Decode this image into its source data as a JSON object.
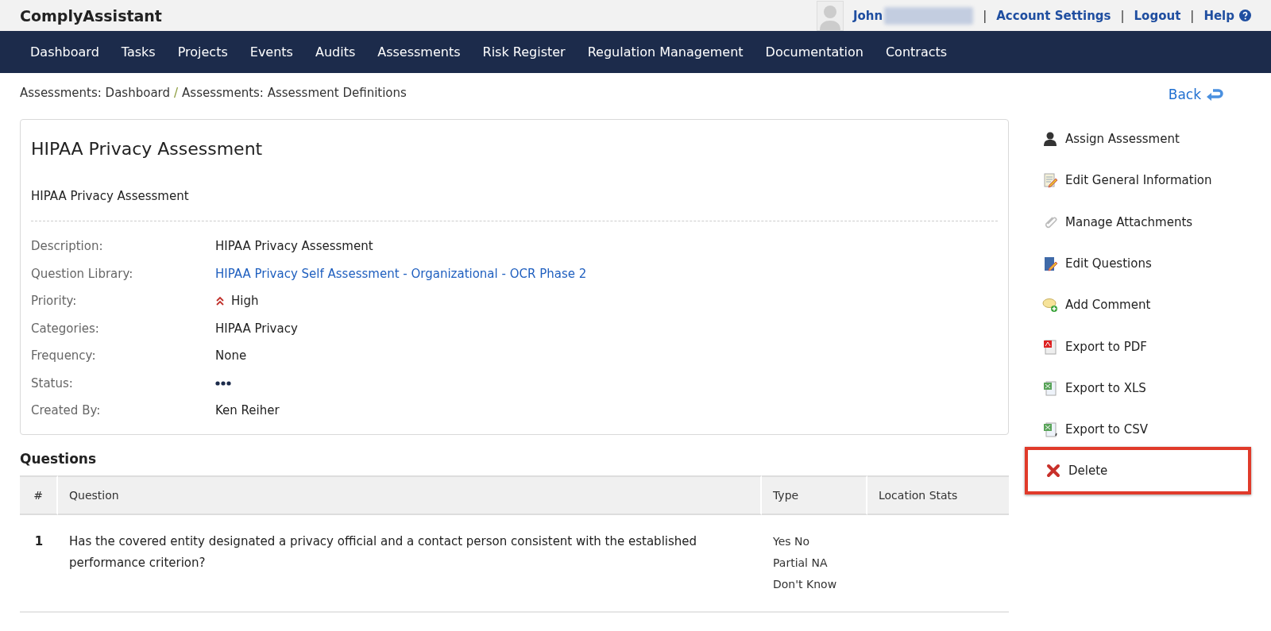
{
  "app_title": "ComplyAssistant",
  "user_menu": {
    "user_name": "John",
    "link_separator": "|",
    "links": [
      "Account Settings",
      "Logout",
      "Help"
    ]
  },
  "nav": [
    "Dashboard",
    "Tasks",
    "Projects",
    "Events",
    "Audits",
    "Assessments",
    "Risk Register",
    "Regulation Management",
    "Documentation",
    "Contracts"
  ],
  "breadcrumb": [
    "Assessments: Dashboard",
    "Assessments: Assessment Definitions"
  ],
  "separator": "/",
  "back_link": "Back",
  "assessment": {
    "title": "HIPAA Privacy Assessment",
    "subtitle": "HIPAA Privacy Assessment",
    "fields": [
      {
        "label": "Description:",
        "value": "HIPAA Privacy Assessment",
        "kind": "text"
      },
      {
        "label": "Question Library:",
        "value": "HIPAA Privacy Self Assessment - Organizational - OCR Phase 2",
        "kind": "link"
      },
      {
        "label": "Priority:",
        "value": "High",
        "kind": "priority"
      },
      {
        "label": "Categories:",
        "value": "HIPAA Privacy",
        "kind": "text"
      },
      {
        "label": "Frequency:",
        "value": "None",
        "kind": "text"
      },
      {
        "label": "Status:",
        "kind": "dots"
      },
      {
        "label": "Created By:",
        "value": "Ken Reiher",
        "kind": "text"
      }
    ]
  },
  "actions": [
    {
      "label": "Assign Assessment",
      "highlighted": false
    },
    {
      "label": "Edit General Information",
      "highlighted": false
    },
    {
      "label": "Manage Attachments",
      "highlighted": false
    },
    {
      "label": "Edit Questions",
      "highlighted": false
    },
    {
      "label": "Add Comment",
      "highlighted": false
    },
    {
      "label": "Export to PDF",
      "highlighted": false
    },
    {
      "label": "Export to XLS",
      "highlighted": false
    },
    {
      "label": "Export to CSV",
      "highlighted": false
    },
    {
      "label": "Delete",
      "highlighted": true
    }
  ],
  "questions": {
    "heading": "Questions",
    "columns": [
      "#",
      "Question",
      "Type",
      "Location Stats"
    ],
    "rows": [
      {
        "number": "1",
        "question": "Has the covered entity designated a privacy official and a contact person consistent with the established performance criterion?",
        "type": [
          "Yes No",
          "Partial NA",
          "Don't Know"
        ]
      }
    ]
  }
}
